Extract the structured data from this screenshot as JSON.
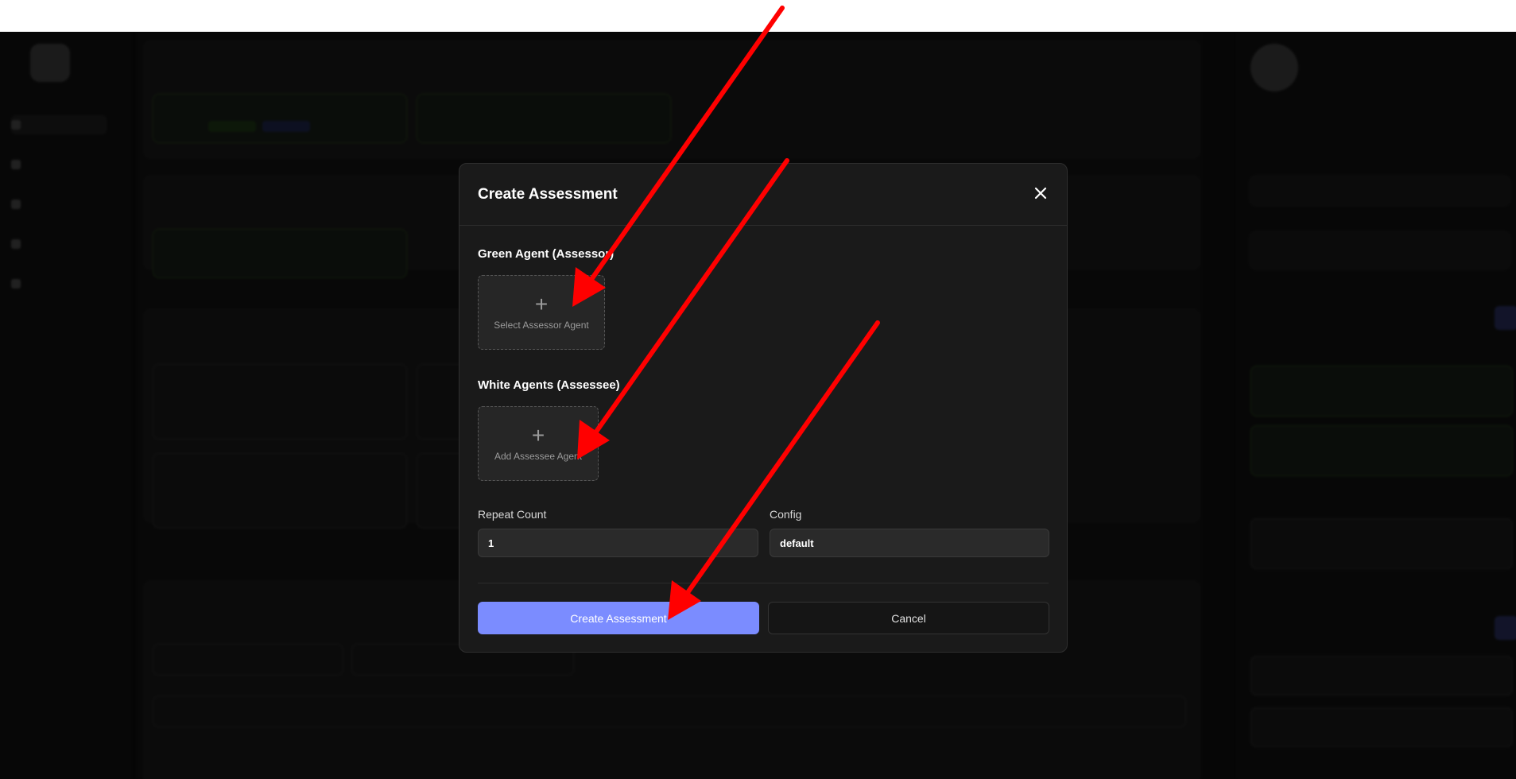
{
  "modal": {
    "title": "Create Assessment",
    "green_section_label": "Green Agent (Assessor)",
    "select_assessor_label": "Select Assessor Agent",
    "white_section_label": "White Agents (Assessee)",
    "add_assessee_label": "Add Assessee Agent",
    "plus_symbol": "+",
    "repeat_count_label": "Repeat Count",
    "repeat_count_value": "1",
    "config_label": "Config",
    "config_value": "default",
    "create_button": "Create Assessment",
    "cancel_button": "Cancel"
  },
  "colors": {
    "primary": "#7b8cff",
    "modal_bg": "#1a1a1a",
    "arrow": "#ff0000"
  },
  "icons": [
    "close-icon",
    "plus-icon",
    "annotation-arrow"
  ]
}
